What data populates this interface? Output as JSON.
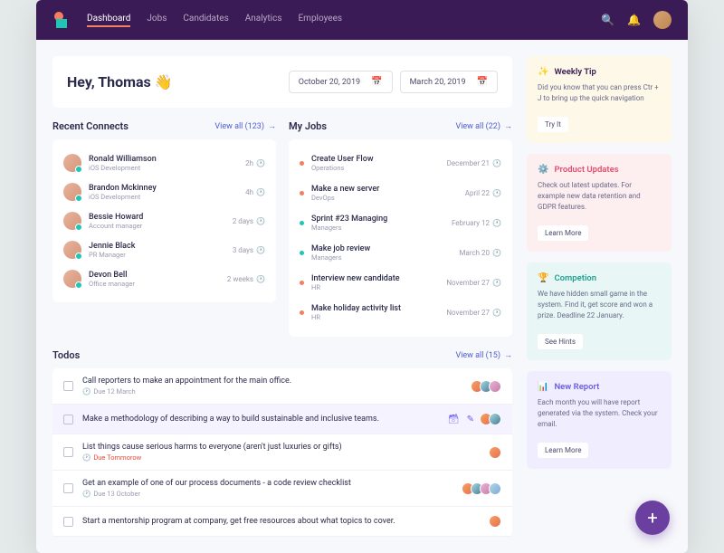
{
  "nav": {
    "items": [
      "Dashboard",
      "Jobs",
      "Candidates",
      "Analytics",
      "Employees"
    ],
    "active": 0
  },
  "hero": {
    "greeting": "Hey, Thomas 👋",
    "date1": "October 20, 2019",
    "date2": "March 20, 2019"
  },
  "connects": {
    "title": "Recent Connects",
    "view_all": "View all (123)",
    "rows": [
      {
        "name": "Ronald Williamson",
        "role": "iOS Development",
        "time": "2h"
      },
      {
        "name": "Brandon Mckinney",
        "role": "iOS Development",
        "time": "4h"
      },
      {
        "name": "Bessie Howard",
        "role": "Account manager",
        "time": "2 days"
      },
      {
        "name": "Jennie Black",
        "role": "PR Manager",
        "time": "3 days"
      },
      {
        "name": "Devon Bell",
        "role": "Office manager",
        "time": "2 weeks"
      }
    ]
  },
  "jobs": {
    "title": "My Jobs",
    "view_all": "View all (22)",
    "rows": [
      {
        "name": "Create User Flow",
        "dept": "Operations",
        "date": "December 21",
        "color": "#f47e5f"
      },
      {
        "name": "Make a new server",
        "dept": "DevOps",
        "date": "April 22",
        "color": "#f47e5f"
      },
      {
        "name": "Sprint #23 Managing",
        "dept": "Managers",
        "date": "February 12",
        "color": "#21c5b5"
      },
      {
        "name": "Make job review",
        "dept": "Managers",
        "date": "March 20",
        "color": "#21c5b5"
      },
      {
        "name": "Interview new candidate",
        "dept": "HR",
        "date": "November 27",
        "color": "#f47e5f"
      },
      {
        "name": "Make holiday activity list",
        "dept": "HR",
        "date": "November 27",
        "color": "#f47e5f"
      }
    ]
  },
  "todos": {
    "title": "Todos",
    "view_all": "View all (15)",
    "rows": [
      {
        "title": "Call reporters to make an appointment for the main office.",
        "due": "Due 12 March",
        "avatars": 3
      },
      {
        "title": "Make a methodology of describing a way to build sustainable and inclusive teams.",
        "due": "",
        "avatars": 2,
        "active": true
      },
      {
        "title": "List things cause serious harms to everyone (aren't just luxuries or gifts)",
        "due": "Due Tommorow",
        "red": true,
        "avatars": 1
      },
      {
        "title": "Get an example of one of our process documents - a code review checklist",
        "due": "Due 13 October",
        "avatars": 4
      },
      {
        "title": "Start a mentorship program at company, get free resources about what topics to cover.",
        "due": "",
        "avatars": 1
      }
    ]
  },
  "tips": [
    {
      "cls": "tip-yellow",
      "icon": "✨",
      "title": "Weekly Tip",
      "body": "Did you know that you can press Ctr + J to bring up the quick navigation",
      "btn": "Try It"
    },
    {
      "cls": "tip-pink",
      "icon": "⚙️",
      "title": "Product Updates",
      "body": "Check out latest updates. For example new data retention and GDPR features.",
      "btn": "Learn More"
    },
    {
      "cls": "tip-teal",
      "icon": "🏆",
      "title": "Competion",
      "body": "We have hidden small game in the system. Find it, get score and won a prize. Deadline 22 January.",
      "btn": "See Hints"
    },
    {
      "cls": "tip-purple",
      "icon": "📊",
      "title": "New Report",
      "body": "Each month you will have report generated via the system. Check your email.",
      "btn": "Learn More"
    }
  ]
}
